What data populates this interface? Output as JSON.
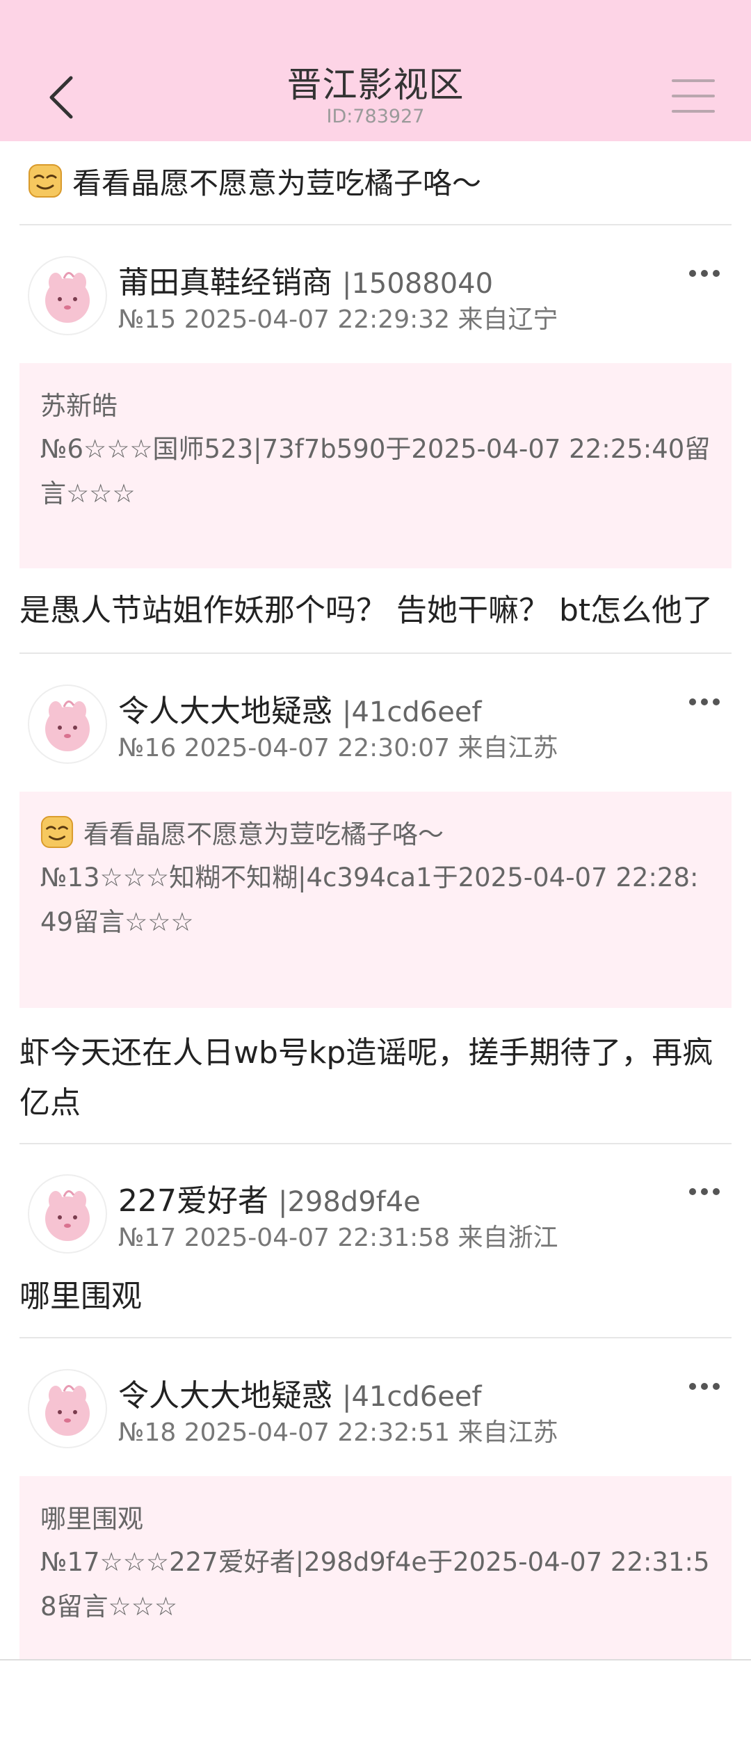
{
  "header": {
    "title": "晋江影视区",
    "subtitle": "ID:783927"
  },
  "thread_intro": {
    "text": "看看晶愿不愿意为荳吃橘子咯～"
  },
  "posts": [
    {
      "author": "莆田真鞋经销商",
      "uid": "|15088040",
      "meta": "№15 2025-04-07 22:29:32 来自辽宁",
      "quote_title": "苏新皓",
      "quote_body": "№6☆☆☆国师523|73f7b590于2025-04-07 22:25:40留言☆☆☆",
      "content": "是愚人节站姐作妖那个吗？ 告她干嘛？ bt怎么他了"
    },
    {
      "author": "令人大大地疑惑",
      "uid": "|41cd6eef",
      "meta": "№16 2025-04-07 22:30:07 来自江苏",
      "quote_title": "看看晶愿不愿意为荳吃橘子咯～",
      "quote_body": "№13☆☆☆知糊不知糊|4c394ca1于2025-04-07 22:28:49留言☆☆☆",
      "content": "虾今天还在人日wb号kp造谣呢，搓手期待了，再疯亿点"
    },
    {
      "author": "227爱好者",
      "uid": "|298d9f4e",
      "meta": "№17 2025-04-07 22:31:58 来自浙江",
      "content": "哪里围观"
    },
    {
      "author": "令人大大地疑惑",
      "uid": "|41cd6eef",
      "meta": "№18 2025-04-07 22:32:51 来自江苏",
      "quote_title": "哪里围观",
      "quote_body": "№17☆☆☆227爱好者|298d9f4e于2025-04-07 22:31:58留言☆☆☆"
    }
  ],
  "colors": {
    "header_bg": "#fdd4e6",
    "quote_bg": "#fff0f5"
  },
  "icons": {
    "back": "chevron-left-icon",
    "menu": "hamburger-menu-icon",
    "more": "more-dots-icon",
    "emoji": "smirk-emoji-icon",
    "avatar": "pink-creature-avatar"
  }
}
